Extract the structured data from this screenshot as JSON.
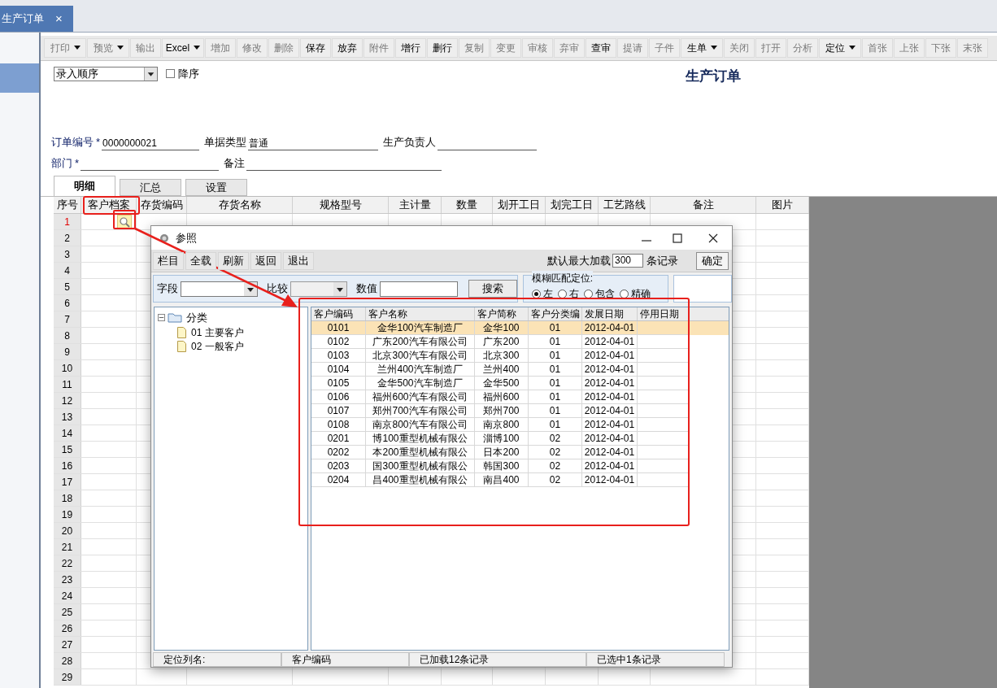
{
  "tab": {
    "title": "生产订单",
    "close": "×"
  },
  "toolbar": [
    {
      "label": "打印",
      "enabled": false,
      "dropdown": true
    },
    {
      "label": "预览",
      "enabled": false,
      "dropdown": true
    },
    {
      "label": "输出",
      "enabled": false,
      "dropdown": false
    },
    {
      "label": "Excel",
      "enabled": true,
      "dropdown": true
    },
    {
      "label": "增加",
      "enabled": false,
      "dropdown": false
    },
    {
      "label": "修改",
      "enabled": false,
      "dropdown": false
    },
    {
      "label": "删除",
      "enabled": false,
      "dropdown": false
    },
    {
      "label": "保存",
      "enabled": true,
      "dropdown": false
    },
    {
      "label": "放弃",
      "enabled": true,
      "dropdown": false
    },
    {
      "label": "附件",
      "enabled": false,
      "dropdown": false
    },
    {
      "label": "增行",
      "enabled": true,
      "dropdown": false
    },
    {
      "label": "删行",
      "enabled": true,
      "dropdown": false
    },
    {
      "label": "复制",
      "enabled": false,
      "dropdown": false
    },
    {
      "label": "变更",
      "enabled": false,
      "dropdown": false
    },
    {
      "label": "审核",
      "enabled": false,
      "dropdown": false
    },
    {
      "label": "弃审",
      "enabled": false,
      "dropdown": false
    },
    {
      "label": "查审",
      "enabled": true,
      "dropdown": false
    },
    {
      "label": "提请",
      "enabled": false,
      "dropdown": false
    },
    {
      "label": "子件",
      "enabled": false,
      "dropdown": false
    },
    {
      "label": "生单",
      "enabled": true,
      "dropdown": true
    },
    {
      "label": "关闭",
      "enabled": false,
      "dropdown": false
    },
    {
      "label": "打开",
      "enabled": false,
      "dropdown": false
    },
    {
      "label": "分析",
      "enabled": false,
      "dropdown": false
    },
    {
      "label": "定位",
      "enabled": true,
      "dropdown": true
    },
    {
      "label": "首张",
      "enabled": false,
      "dropdown": false
    },
    {
      "label": "上张",
      "enabled": false,
      "dropdown": false
    },
    {
      "label": "下张",
      "enabled": false,
      "dropdown": false
    },
    {
      "label": "末张",
      "enabled": false,
      "dropdown": false
    }
  ],
  "sort": {
    "value": "录入顺序",
    "descending": {
      "label": "降序",
      "checked": false
    }
  },
  "title": "生产订单",
  "fields": [
    [
      {
        "label": "订单编号",
        "required_mark": "*",
        "value": "0000000021"
      },
      {
        "label": "单据类型",
        "value": "普通"
      },
      {
        "label": "生产负责人"
      }
    ],
    [
      {
        "label": "部门",
        "required_mark": "*"
      },
      {
        "label": "备注"
      }
    ]
  ],
  "tabs": [
    {
      "label": "明细",
      "selected": true
    },
    {
      "label": "汇总",
      "selected": false
    },
    {
      "label": "设置",
      "selected": false
    }
  ],
  "grid": {
    "columns": [
      "序号",
      "客户档案",
      "存货编码",
      "存货名称",
      "规格型号",
      "主计量",
      "数量",
      "划开工日",
      "划完工日",
      "工艺路线",
      "备注",
      "图片"
    ],
    "rows": [
      {
        "number": "1",
        "current": true
      },
      {
        "number": "2",
        "current": false
      },
      {
        "number": "3",
        "current": false
      },
      {
        "number": "4",
        "current": false
      },
      {
        "number": "5",
        "current": false
      },
      {
        "number": "6",
        "current": false
      },
      {
        "number": "7",
        "current": false
      },
      {
        "number": "8",
        "current": false
      },
      {
        "number": "9",
        "current": false
      },
      {
        "number": "10",
        "current": false
      },
      {
        "number": "11",
        "current": false
      },
      {
        "number": "12",
        "current": false
      },
      {
        "number": "13",
        "current": false
      },
      {
        "number": "14",
        "current": false
      },
      {
        "number": "15",
        "current": false
      },
      {
        "number": "16",
        "current": false
      },
      {
        "number": "17",
        "current": false
      },
      {
        "number": "18",
        "current": false
      },
      {
        "number": "19",
        "current": false
      },
      {
        "number": "20",
        "current": false
      },
      {
        "number": "21",
        "current": false
      },
      {
        "number": "22",
        "current": false
      },
      {
        "number": "23",
        "current": false
      },
      {
        "number": "24",
        "current": false
      },
      {
        "number": "25",
        "current": false
      },
      {
        "number": "26",
        "current": false
      },
      {
        "number": "27",
        "current": false
      },
      {
        "number": "28",
        "current": false
      },
      {
        "number": "29",
        "current": false
      }
    ]
  },
  "dialog": {
    "title": "参照",
    "toolbar": [
      "栏目",
      "全载",
      "刷新",
      "返回",
      "退出"
    ],
    "max_load": {
      "label": "默认最大加载",
      "value": "300",
      "unit": "条记录"
    },
    "confirm": "确定",
    "search": {
      "field_label": "字段",
      "compare_label": "比较",
      "value_label": "数值",
      "button": "搜索"
    },
    "match": {
      "title": "模糊匹配定位:",
      "options": [
        {
          "label": "左",
          "selected": true
        },
        {
          "label": "右",
          "selected": false
        },
        {
          "label": "包含",
          "selected": false
        },
        {
          "label": "精确",
          "selected": false
        }
      ]
    },
    "tree": {
      "label": "分类",
      "expanded": true,
      "children": [
        {
          "code": "01",
          "label": "主要客户"
        },
        {
          "code": "02",
          "label": "一般客户"
        }
      ]
    },
    "table": {
      "columns": [
        "客户编码",
        "客户名称",
        "客户简称",
        "客户分类编",
        "发展日期",
        "停用日期"
      ],
      "rows": [
        {
          "selected": true,
          "cells": [
            "0101",
            "金华100汽车制造厂",
            "金华100",
            "01",
            "2012-04-01"
          ]
        },
        {
          "selected": false,
          "cells": [
            "0102",
            "广东200汽车有限公司",
            "广东200",
            "01",
            "2012-04-01"
          ]
        },
        {
          "selected": false,
          "cells": [
            "0103",
            "北京300汽车有限公司",
            "北京300",
            "01",
            "2012-04-01"
          ]
        },
        {
          "selected": false,
          "cells": [
            "0104",
            "兰州400汽车制造厂",
            "兰州400",
            "01",
            "2012-04-01"
          ]
        },
        {
          "selected": false,
          "cells": [
            "0105",
            "金华500汽车制造厂",
            "金华500",
            "01",
            "2012-04-01"
          ]
        },
        {
          "selected": false,
          "cells": [
            "0106",
            "福州600汽车有限公司",
            "福州600",
            "01",
            "2012-04-01"
          ]
        },
        {
          "selected": false,
          "cells": [
            "0107",
            "郑州700汽车有限公司",
            "郑州700",
            "01",
            "2012-04-01"
          ]
        },
        {
          "selected": false,
          "cells": [
            "0108",
            "南京800汽车有限公司",
            "南京800",
            "01",
            "2012-04-01"
          ]
        },
        {
          "selected": false,
          "cells": [
            "0201",
            "博100重型机械有限公",
            "淄博100",
            "02",
            "2012-04-01"
          ]
        },
        {
          "selected": false,
          "cells": [
            "0202",
            "本200重型机械有限公",
            "日本200",
            "02",
            "2012-04-01"
          ]
        },
        {
          "selected": false,
          "cells": [
            "0203",
            "国300重型机械有限公",
            "韩国300",
            "02",
            "2012-04-01"
          ]
        },
        {
          "selected": false,
          "cells": [
            "0204",
            "昌400重型机械有限公",
            "南昌400",
            "02",
            "2012-04-01"
          ]
        }
      ]
    },
    "status_bar": [
      "定位列名:",
      "客户编码",
      "已加载12条记录",
      "已选中1条记录"
    ]
  }
}
